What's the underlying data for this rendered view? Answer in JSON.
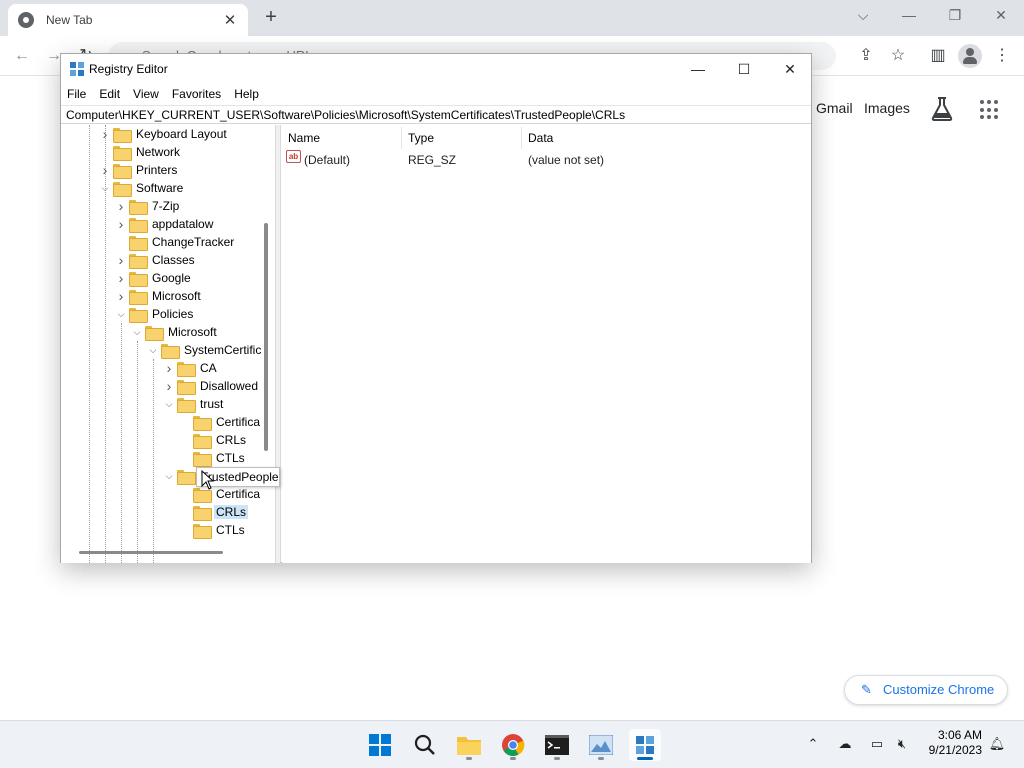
{
  "browser": {
    "tab_title": "New Tab",
    "omnibox_text": "Search Google or type a URL",
    "ntp": {
      "gmail": "Gmail",
      "images": "Images",
      "customize": "Customize Chrome"
    }
  },
  "regedit": {
    "title": "Registry Editor",
    "menu": [
      "File",
      "Edit",
      "View",
      "Favorites",
      "Help"
    ],
    "address": "Computer\\HKEY_CURRENT_USER\\Software\\Policies\\Microsoft\\SystemCertificates\\TrustedPeople\\CRLs",
    "tree": [
      {
        "label": "Keyboard Layout",
        "depth": 0,
        "chevron": "collapsed"
      },
      {
        "label": "Network",
        "depth": 0,
        "chevron": "none"
      },
      {
        "label": "Printers",
        "depth": 0,
        "chevron": "collapsed"
      },
      {
        "label": "Software",
        "depth": 0,
        "chevron": "expanded"
      },
      {
        "label": "7-Zip",
        "depth": 1,
        "chevron": "collapsed"
      },
      {
        "label": "appdatalow",
        "depth": 1,
        "chevron": "collapsed"
      },
      {
        "label": "ChangeTracker",
        "depth": 1,
        "chevron": "none"
      },
      {
        "label": "Classes",
        "depth": 1,
        "chevron": "collapsed"
      },
      {
        "label": "Google",
        "depth": 1,
        "chevron": "collapsed"
      },
      {
        "label": "Microsoft",
        "depth": 1,
        "chevron": "collapsed"
      },
      {
        "label": "Policies",
        "depth": 1,
        "chevron": "expanded"
      },
      {
        "label": "Microsoft",
        "depth": 2,
        "chevron": "expanded"
      },
      {
        "label": "SystemCertific",
        "depth": 3,
        "chevron": "expanded"
      },
      {
        "label": "CA",
        "depth": 4,
        "chevron": "collapsed"
      },
      {
        "label": "Disallowed",
        "depth": 4,
        "chevron": "collapsed"
      },
      {
        "label": "trust",
        "depth": 4,
        "chevron": "expanded"
      },
      {
        "label": "Certifica",
        "depth": 5,
        "chevron": "none"
      },
      {
        "label": "CRLs",
        "depth": 5,
        "chevron": "none"
      },
      {
        "label": "CTLs",
        "depth": 5,
        "chevron": "none"
      },
      {
        "label": "",
        "depth": 4,
        "chevron": "expanded"
      },
      {
        "label": "Certifica",
        "depth": 5,
        "chevron": "none"
      },
      {
        "label": "CRLs",
        "depth": 5,
        "chevron": "none",
        "selected": true
      },
      {
        "label": "CTLs",
        "depth": 5,
        "chevron": "none"
      }
    ],
    "tooltip": "TrustedPeople",
    "columns": [
      "Name",
      "Type",
      "Data"
    ],
    "values": [
      {
        "name": "(Default)",
        "type": "REG_SZ",
        "data": "(value not set)"
      }
    ]
  },
  "taskbar": {
    "time": "3:06 AM",
    "date": "9/21/2023"
  }
}
